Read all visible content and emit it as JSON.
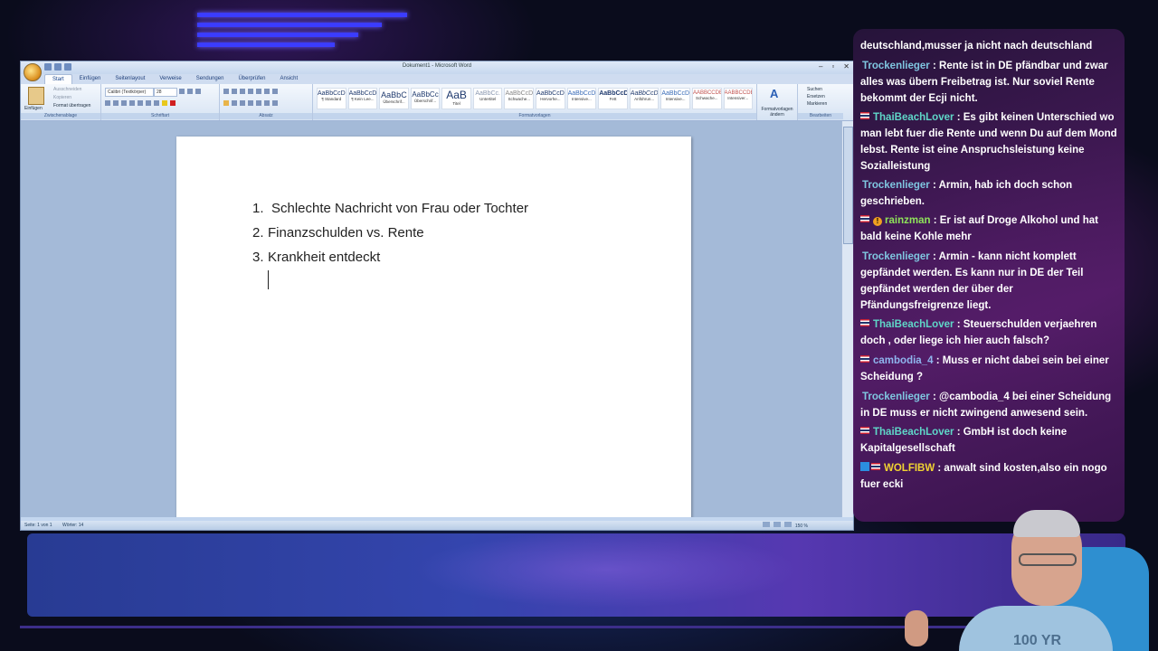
{
  "word": {
    "window_title": "Dokument1 - Microsoft Word",
    "tabs": [
      "Start",
      "Einfügen",
      "Seitenlayout",
      "Verweise",
      "Sendungen",
      "Überprüfen",
      "Ansicht"
    ],
    "clipboard": {
      "paste": "Einfügen",
      "cut": "Ausschneiden",
      "copy": "Kopieren",
      "format_painter": "Format übertragen",
      "group": "Zwischenablage"
    },
    "font": {
      "name": "Calibri (Textkörper)",
      "size": "28",
      "group": "Schriftart"
    },
    "paragraph_group": "Absatz",
    "styles": [
      {
        "sample": "AaBbCcDc",
        "name": "¶ Standard"
      },
      {
        "sample": "AaBbCcDc",
        "name": "¶ Kein Lee..."
      },
      {
        "sample": "AaBbC",
        "name": "Überschrif..."
      },
      {
        "sample": "AaBbCc",
        "name": "Überschrif..."
      },
      {
        "sample": "AaB",
        "name": "Titel"
      },
      {
        "sample": "AaBbCc.",
        "name": "Untertitel"
      },
      {
        "sample": "AaBbCcDc",
        "name": "Schwache..."
      },
      {
        "sample": "AaBbCcDc",
        "name": "Hervorhe..."
      },
      {
        "sample": "AaBbCcDc",
        "name": "Intensive..."
      },
      {
        "sample": "AaBbCcDc",
        "name": "Fett"
      },
      {
        "sample": "AaBbCcDc",
        "name": "Anführun..."
      },
      {
        "sample": "AaBbCcDc",
        "name": "Intensive..."
      },
      {
        "sample": "AABBCCDE",
        "name": "Schwache..."
      },
      {
        "sample": "AABBCCDE",
        "name": "Intensiver..."
      }
    ],
    "styles_group": "Formatvorlagen",
    "change_styles": "Formatvorlagen ändern",
    "editing": {
      "find": "Suchen",
      "replace": "Ersetzen",
      "select": "Markieren",
      "group": "Bearbeiten"
    },
    "document_lines": [
      {
        "num": "1.",
        "text": "Schlechte Nachricht von Frau oder Tochter"
      },
      {
        "num": "2.",
        "text": "Finanzschulden vs. Rente"
      },
      {
        "num": "3.",
        "text": "Krankheit entdeckt"
      }
    ],
    "status": {
      "page": "Seite: 1 von 1",
      "words": "Wörter: 14",
      "zoom": "150 %"
    }
  },
  "chat": [
    {
      "user": "",
      "text": "deutschland,musser ja nicht nach deutschland"
    },
    {
      "user": "Trockenlieger",
      "text": ": Rente ist in DE pfändbar und zwar alles was übern Freibetrag ist. Nur soviel Rente bekommt der Ecji nicht."
    },
    {
      "user": "ThaiBeachLover",
      "text": ": Es gibt keinen Unterschied wo man lebt fuer die Rente und wenn Du auf dem Mond lebst. Rente ist eine Anspruchsleistung keine Sozialleistung"
    },
    {
      "user": "Trockenlieger",
      "text": ": Armin, hab ich doch schon geschrieben."
    },
    {
      "user": "rainzman",
      "text": ": Er ist auf Droge Alkohol und hat bald keine Kohle mehr"
    },
    {
      "user": "Trockenlieger",
      "text": ": Armin - kann nicht komplett gepfändet werden. Es kann nur in DE der Teil gepfändet werden der über der Pfändungsfreigrenze liegt."
    },
    {
      "user": "ThaiBeachLover",
      "text": ": Steuerschulden verjaehren doch , oder liege ich hier auch falsch?"
    },
    {
      "user": "cambodia_4",
      "text": ": Muss er nicht dabei sein bei einer Scheidung ?"
    },
    {
      "user": "Trockenlieger",
      "text": ": @cambodia_4 bei einer Scheidung in DE muss er nicht zwingend anwesend sein."
    },
    {
      "user": "ThaiBeachLover",
      "text": ": GmbH ist doch keine Kapitalgesellschaft"
    },
    {
      "user": "WOLFIBW",
      "text": ": anwalt sind kosten,also ein nogo fuer ecki"
    }
  ],
  "webcam": {
    "shirt_text": "100 YR"
  },
  "colors": {
    "accent_bars": "#3b3cff",
    "chat_bg": "#5a1e6e",
    "ribbon": "#d6e3f3"
  }
}
